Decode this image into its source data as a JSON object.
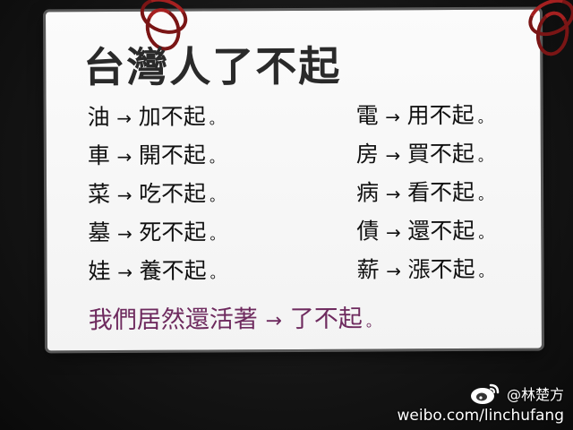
{
  "sign": {
    "title": "台灣人了不起",
    "arrow": "→",
    "left_items": [
      {
        "src": "油",
        "result": "加不起",
        "punct": "。"
      },
      {
        "src": "車",
        "result": "開不起",
        "punct": "。"
      },
      {
        "src": "菜",
        "result": "吃不起",
        "punct": "。"
      },
      {
        "src": "墓",
        "result": "死不起",
        "punct": "。"
      },
      {
        "src": "娃",
        "result": "養不起",
        "punct": "。"
      }
    ],
    "right_items": [
      {
        "src": "電",
        "result": "用不起",
        "punct": "。"
      },
      {
        "src": "房",
        "result": "買不起",
        "punct": "。"
      },
      {
        "src": "病",
        "result": "看不起",
        "punct": "。"
      },
      {
        "src": "債",
        "result": "還不起",
        "punct": "。"
      },
      {
        "src": "薪",
        "result": "漲不起",
        "punct": "。"
      }
    ],
    "conclusion": {
      "text": "我們居然還活著",
      "result": "了不起",
      "punct": "。",
      "color": "#6e2a5e"
    }
  },
  "watermark": {
    "handle": "@林楚方",
    "url": "weibo.com/linchufang",
    "logo_icon": "weibo-logo-icon"
  }
}
